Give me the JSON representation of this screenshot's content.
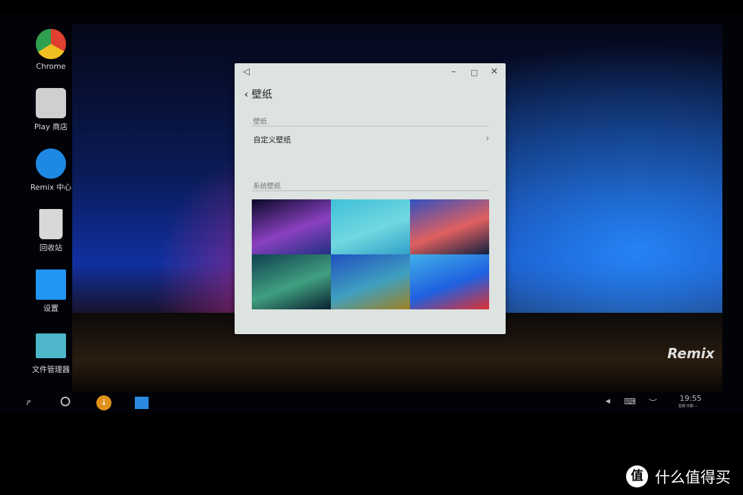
{
  "desktop": {
    "icons": [
      {
        "label": "Chrome",
        "color": "#e04030"
      },
      {
        "label": "Play 商店",
        "color": "#cfcfcf"
      },
      {
        "label": "Remix 中心",
        "color": "#1e88e5"
      },
      {
        "label": "回收站",
        "color": "#d8d8d8"
      },
      {
        "label": "设置",
        "color": "#2196f3"
      },
      {
        "label": "文件管理器",
        "color": "#4db6c8"
      }
    ],
    "brand": "Remix"
  },
  "window": {
    "back_icon": "◁",
    "minimize": "–",
    "maximize": "□",
    "close": "✕",
    "title": "壁纸",
    "section1": "壁纸",
    "custom_item": "自定义壁纸",
    "section2": "系统壁纸",
    "wallpapers": [
      {
        "name": "aurora",
        "colors": [
          "#0a0a2a",
          "#8a40c0",
          "#203080"
        ]
      },
      {
        "name": "cyan-water",
        "colors": [
          "#40c0d8",
          "#70d8e0",
          "#30a0c8"
        ]
      },
      {
        "name": "mountain-sunset",
        "colors": [
          "#3050c0",
          "#e06060",
          "#102040"
        ]
      },
      {
        "name": "green-wave",
        "colors": [
          "#104050",
          "#40a080",
          "#0a2030"
        ]
      },
      {
        "name": "blue-aerial",
        "colors": [
          "#2050c0",
          "#40a0c0",
          "#a08020"
        ]
      },
      {
        "name": "material",
        "colors": [
          "#40b0e8",
          "#2060e0",
          "#e03030"
        ]
      }
    ]
  },
  "taskbar": {
    "time": "19:55",
    "date": "星期 日期 —"
  },
  "watermark": {
    "logo": "值",
    "text": "什么值得买"
  }
}
